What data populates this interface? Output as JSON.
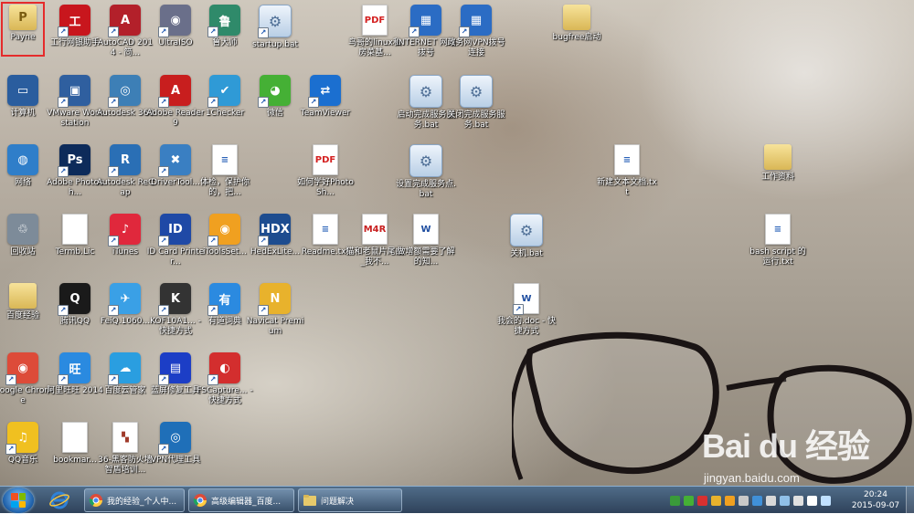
{
  "desktop": {
    "icons": [
      {
        "id": "payne",
        "label": "Payne",
        "glyph": "P",
        "type": "folder",
        "color": "#d9b756",
        "shortcut": false,
        "selected": true
      },
      {
        "id": "icbc",
        "label": "工行网银助手",
        "glyph": "工",
        "type": "app",
        "color": "#c8161d",
        "shortcut": true
      },
      {
        "id": "autocad",
        "label": "AutoCAD 2014 - 简...",
        "glyph": "A",
        "type": "app",
        "color": "#b3202a",
        "shortcut": true
      },
      {
        "id": "ultraiso",
        "label": "UltraISO",
        "glyph": "◉",
        "type": "app",
        "color": "#6a6f8a",
        "shortcut": true
      },
      {
        "id": "ludashi",
        "label": "鲁大师",
        "glyph": "鲁",
        "type": "app",
        "color": "#2f8a6a",
        "shortcut": true
      },
      {
        "id": "startup-bat",
        "label": "startup.bat",
        "glyph": "⚙",
        "type": "gear",
        "color": "#b9cfe6",
        "shortcut": true
      },
      {
        "id": "linux-pdf",
        "label": "鸟哥的linux私房菜基...",
        "glyph": "PDF",
        "type": "file",
        "color": "#d42020",
        "shortcut": false
      },
      {
        "id": "internet-dial",
        "label": "INTERNET 网络拨号",
        "glyph": "▦",
        "type": "app",
        "color": "#2b6cc4",
        "shortcut": true
      },
      {
        "id": "gov-vpn",
        "label": "政务网VPN拨号连接",
        "glyph": "▦",
        "type": "app",
        "color": "#2b6cc4",
        "shortcut": true
      },
      {
        "id": "bugfree",
        "label": "bugfree启动",
        "glyph": "",
        "type": "folder",
        "color": "#d9b756",
        "shortcut": false
      },
      {
        "id": "computer",
        "label": "计算机",
        "glyph": "▭",
        "type": "app",
        "color": "#2a5d9e",
        "shortcut": false
      },
      {
        "id": "vmware",
        "label": "VMware Workstation",
        "glyph": "▣",
        "type": "app",
        "color": "#2f5f9f",
        "shortcut": true
      },
      {
        "id": "autodesk360",
        "label": "Autodesk 360",
        "glyph": "◎",
        "type": "app",
        "color": "#3d7fb6",
        "shortcut": true
      },
      {
        "id": "adobe-reader",
        "label": "Adobe Reader 9",
        "glyph": "A",
        "type": "app",
        "color": "#c81e1e",
        "shortcut": true
      },
      {
        "id": "1checker",
        "label": "1Checker",
        "glyph": "✔",
        "type": "app",
        "color": "#2f9ad6",
        "shortcut": true
      },
      {
        "id": "wechat",
        "label": "微信",
        "glyph": "◕",
        "type": "app",
        "color": "#45b035",
        "shortcut": true
      },
      {
        "id": "teamviewer",
        "label": "TeamViewer",
        "glyph": "⇄",
        "type": "app",
        "color": "#1b6fd0",
        "shortcut": true
      },
      {
        "id": "start-service-bat",
        "label": "启动完成服务服务.bat",
        "glyph": "⚙",
        "type": "gear",
        "color": "#b9cfe6",
        "shortcut": false
      },
      {
        "id": "stop-service-bat",
        "label": "关闭完成服务服务.bat",
        "glyph": "⚙",
        "type": "gear",
        "color": "#b9cfe6",
        "shortcut": false
      },
      {
        "id": "network",
        "label": "网络",
        "glyph": "◍",
        "type": "app",
        "color": "#2f7ec9",
        "shortcut": false
      },
      {
        "id": "photoshop",
        "label": "Adobe Photosh...",
        "glyph": "Ps",
        "type": "app",
        "color": "#0d2b5a",
        "shortcut": true
      },
      {
        "id": "recap",
        "label": "Autodesk ReCap",
        "glyph": "R",
        "type": "app",
        "color": "#2a6fb5",
        "shortcut": true
      },
      {
        "id": "drivertool",
        "label": "DriverTool...",
        "glyph": "✖",
        "type": "app",
        "color": "#3a7fc2",
        "shortcut": true
      },
      {
        "id": "health-doc",
        "label": "体检，保护你的，把...",
        "glyph": "≡",
        "type": "file",
        "color": "#ffffff",
        "shortcut": false
      },
      {
        "id": "learn-ps-pdf",
        "label": "如何学好PhotoSh...",
        "glyph": "PDF",
        "type": "file",
        "color": "#d42020",
        "shortcut": false
      },
      {
        "id": "setup-bat",
        "label": "设置完成服务点.bat",
        "glyph": "⚙",
        "type": "gear",
        "color": "#b9cfe6",
        "shortcut": false
      },
      {
        "id": "new-txt",
        "label": "新建文本文档.txt",
        "glyph": "≡",
        "type": "file",
        "color": "#ffffff",
        "shortcut": false
      },
      {
        "id": "work-folder",
        "label": "工作资料",
        "glyph": "",
        "type": "folder",
        "color": "#d9b756",
        "shortcut": false
      },
      {
        "id": "recycle",
        "label": "回收站",
        "glyph": "♲",
        "type": "app",
        "color": "#7d8b99",
        "shortcut": false
      },
      {
        "id": "termb",
        "label": "Termb.Lic",
        "glyph": "",
        "type": "file",
        "color": "#ffffff",
        "shortcut": false
      },
      {
        "id": "itunes",
        "label": "iTunes",
        "glyph": "♪",
        "type": "app",
        "color": "#e0283c",
        "shortcut": true
      },
      {
        "id": "idcard",
        "label": "ID Card Printer...",
        "glyph": "ID",
        "type": "app",
        "color": "#1f49a6",
        "shortcut": true
      },
      {
        "id": "itoolsset",
        "label": "iToolsSet...",
        "glyph": "◉",
        "type": "app",
        "color": "#f0a020",
        "shortcut": true
      },
      {
        "id": "hedexlite",
        "label": "HedExLite...",
        "glyph": "HDX",
        "type": "app",
        "color": "#1d4c8f",
        "shortcut": true
      },
      {
        "id": "readme",
        "label": "Readme.txt",
        "glyph": "≡",
        "type": "file",
        "color": "#ffffff",
        "shortcut": false
      },
      {
        "id": "m4r",
        "label": "猫和老鼠片尾曲_我不...",
        "glyph": "M4R",
        "type": "file",
        "color": "#c82020",
        "shortcut": false
      },
      {
        "id": "doc-request",
        "label": "做增额需要了解的知...",
        "glyph": "W",
        "type": "file",
        "color": "#1f4ea0",
        "shortcut": false
      },
      {
        "id": "close-bat",
        "label": "关机.bat",
        "glyph": "⚙",
        "type": "gear",
        "color": "#b9cfe6",
        "shortcut": false
      },
      {
        "id": "bash-txt",
        "label": "bash script 的运行.txt",
        "glyph": "≡",
        "type": "file",
        "color": "#ffffff",
        "shortcut": false
      },
      {
        "id": "baidu-exp",
        "label": "百度经验",
        "glyph": "",
        "type": "folder",
        "color": "#d9b756",
        "shortcut": false
      },
      {
        "id": "qq",
        "label": "腾讯QQ",
        "glyph": "Q",
        "type": "app",
        "color": "#1a1a1a",
        "shortcut": true
      },
      {
        "id": "feiq",
        "label": "FeiQ.1060...",
        "glyph": "✈",
        "type": "app",
        "color": "#3aa0e6",
        "shortcut": true
      },
      {
        "id": "kof",
        "label": "KOF10A1... - 快捷方式",
        "glyph": "K",
        "type": "app",
        "color": "#333333",
        "shortcut": true
      },
      {
        "id": "youdao",
        "label": "有道词典",
        "glyph": "有",
        "type": "app",
        "color": "#2b8ae0",
        "shortcut": true
      },
      {
        "id": "navicat",
        "label": "Navicat Premium",
        "glyph": "N",
        "type": "app",
        "color": "#e8b22c",
        "shortcut": true
      },
      {
        "id": "my-doc",
        "label": "我会的.doc - 快捷方式",
        "glyph": "W",
        "type": "file",
        "color": "#1f4ea0",
        "shortcut": true
      },
      {
        "id": "chrome",
        "label": "Google Chrome",
        "glyph": "◉",
        "type": "app",
        "color": "#dd4b39",
        "shortcut": true
      },
      {
        "id": "aliwangwang",
        "label": "阿里旺旺 2014",
        "glyph": "旺",
        "type": "app",
        "color": "#2a8ae0",
        "shortcut": true
      },
      {
        "id": "baidu-cloud",
        "label": "百度云管家",
        "glyph": "☁",
        "type": "app",
        "color": "#2a9ee0",
        "shortcut": true
      },
      {
        "id": "bluescreen",
        "label": "蓝屏修复工具",
        "glyph": "▤",
        "type": "app",
        "color": "#1c3ec6",
        "shortcut": true
      },
      {
        "id": "fscapture",
        "label": "FSCapture... - 快捷方式",
        "glyph": "◐",
        "type": "app",
        "color": "#d32e2e",
        "shortcut": true
      },
      {
        "id": "qqmusic",
        "label": "QQ音乐",
        "glyph": "♫",
        "type": "app",
        "color": "#f0c020",
        "shortcut": true
      },
      {
        "id": "bookmark",
        "label": "bookmar...",
        "glyph": "",
        "type": "file",
        "color": "#ffffff",
        "shortcut": false
      },
      {
        "id": "360-firewall",
        "label": "36-黑客防火墙智盾培训...",
        "glyph": "▚",
        "type": "file",
        "color": "#a03a2a",
        "shortcut": false
      },
      {
        "id": "vpn-tool",
        "label": "VPN代理工具",
        "glyph": "◎",
        "type": "app",
        "color": "#1f6fb8",
        "shortcut": true
      }
    ]
  },
  "watermark": {
    "logo": "Bai du 经验",
    "url": "jingyan.baidu.com"
  },
  "taskbar": {
    "pinned": [
      {
        "name": "ie",
        "color": "#2f82d8"
      }
    ],
    "windows": [
      {
        "label": "我的经验_个人中...",
        "icon": "chrome-icon"
      },
      {
        "label": "高级编辑器_百度...",
        "icon": "chrome-icon"
      },
      {
        "label": "问题解决",
        "icon": "folder-icon"
      }
    ],
    "tray_colors": [
      "#3a9a3a",
      "#45b035",
      "#d83030",
      "#e8b22c",
      "#f0a020",
      "#c8c8c8",
      "#4090d8",
      "#d8d8d8",
      "#90c0e8",
      "#e0e0e0",
      "#ffffff",
      "#c0e0ff"
    ],
    "clock": {
      "time": "20:24",
      "date": "2015-09-07"
    }
  }
}
